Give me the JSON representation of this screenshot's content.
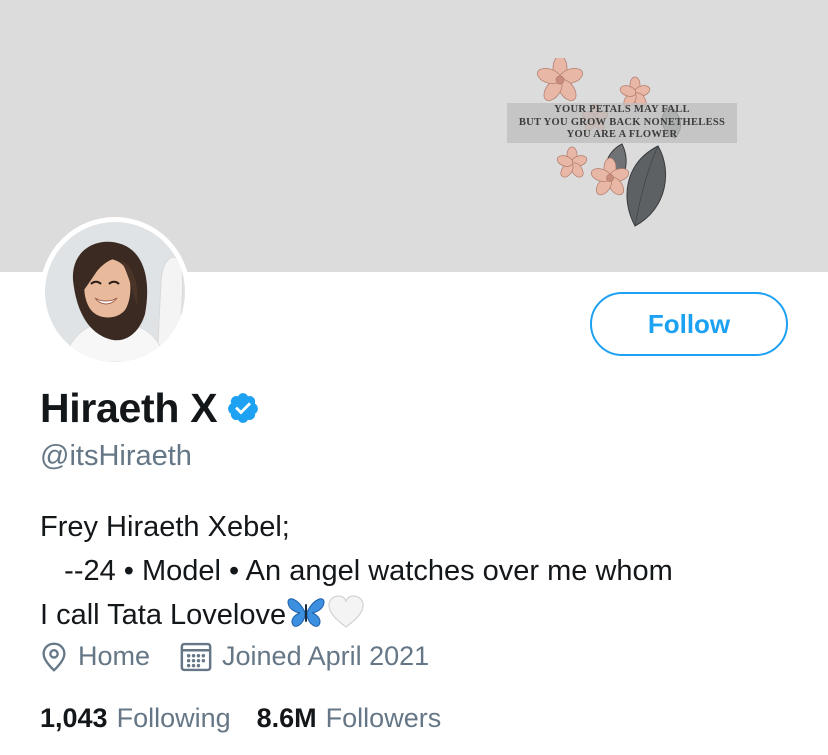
{
  "banner": {
    "quote_lines": [
      "YOUR PETALS MAY FALL",
      "BUT YOU GROW BACK NONETHELESS",
      "YOU ARE A FLOWER"
    ],
    "bg_color": "#dcdcdc"
  },
  "profile": {
    "display_name": "Hiraeth X",
    "verified": true,
    "handle": "@itsHiraeth",
    "bio_lines": [
      "Frey Hiraeth Xebel;",
      "   --24 • Model • An angel watches over me whom",
      "I call Tata Lovelove"
    ],
    "bio_emojis": [
      "butterfly-emoji",
      "white-heart-emoji"
    ],
    "location": "Home",
    "joined": "Joined April 2021"
  },
  "actions": {
    "follow_label": "Follow"
  },
  "stats": {
    "following_count": "1,043",
    "following_label": "Following",
    "followers_count": "8.6M",
    "followers_label": "Followers"
  },
  "colors": {
    "accent": "#1da1f2",
    "muted": "#657786",
    "text": "#14171a"
  },
  "icons": [
    "verified-badge-icon",
    "location-pin-icon",
    "calendar-icon"
  ]
}
